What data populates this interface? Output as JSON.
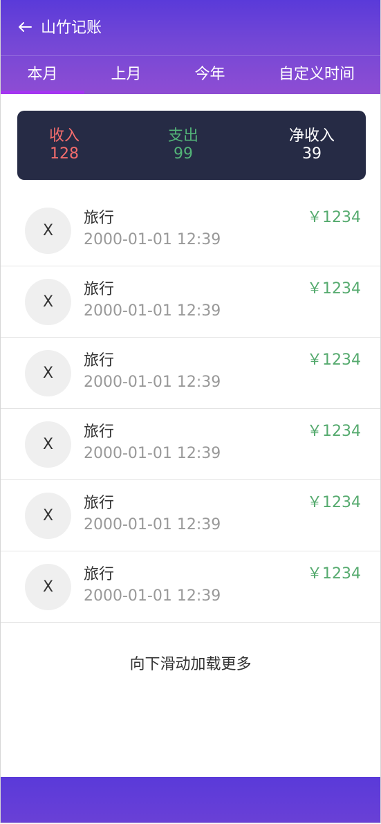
{
  "header": {
    "title": "山竹记账",
    "back_icon": "arrow-left-icon"
  },
  "tabs": [
    {
      "label": "本月",
      "active": true
    },
    {
      "label": "上月",
      "active": false
    },
    {
      "label": "今年",
      "active": false
    },
    {
      "label": "自定义时间",
      "active": false
    }
  ],
  "summary": {
    "income": {
      "label": "收入",
      "value": "128",
      "color": "#f46d6d"
    },
    "expense": {
      "label": "支出",
      "value": "99",
      "color": "#53b478"
    },
    "net": {
      "label": "净收入",
      "value": "39",
      "color": "#ffffff"
    }
  },
  "records": [
    {
      "icon": "X",
      "category": "旅行",
      "time": "2000-01-01 12:39",
      "amount": "￥1234"
    },
    {
      "icon": "X",
      "category": "旅行",
      "time": "2000-01-01 12:39",
      "amount": "￥1234"
    },
    {
      "icon": "X",
      "category": "旅行",
      "time": "2000-01-01 12:39",
      "amount": "￥1234"
    },
    {
      "icon": "X",
      "category": "旅行",
      "time": "2000-01-01 12:39",
      "amount": "￥1234"
    },
    {
      "icon": "X",
      "category": "旅行",
      "time": "2000-01-01 12:39",
      "amount": "￥1234"
    },
    {
      "icon": "X",
      "category": "旅行",
      "time": "2000-01-01 12:39",
      "amount": "￥1234"
    }
  ],
  "footer": {
    "load_more": "向下滑动加载更多"
  },
  "colors": {
    "header_top": "#5a3ad9",
    "header_bottom": "#8e4dd3",
    "tab_indicator": "#a436f0",
    "summary_bg": "#262b45",
    "amount": "#55aa6e"
  }
}
